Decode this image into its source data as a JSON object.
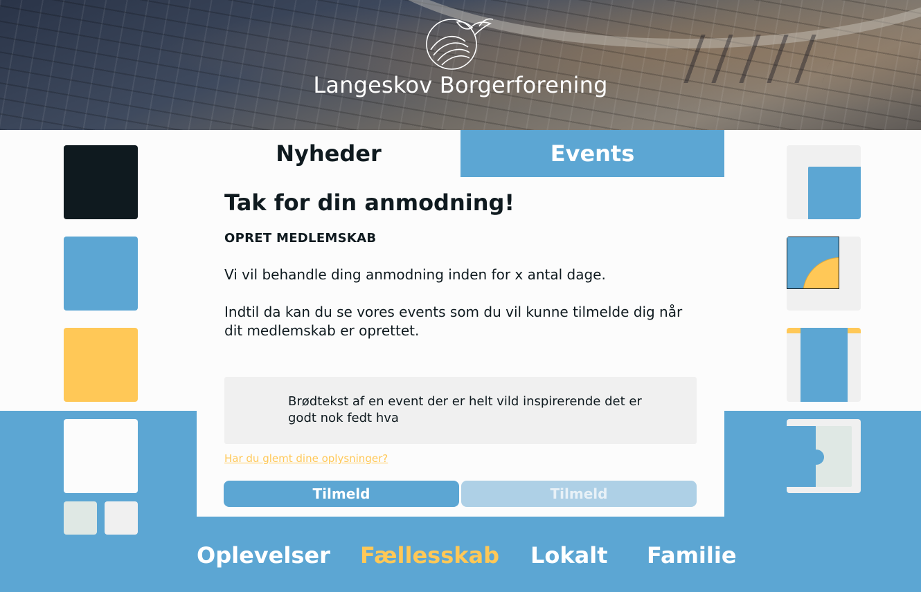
{
  "header": {
    "site_title": "Langeskov Borgerforening"
  },
  "tabs": {
    "news": "Nyheder",
    "events": "Events"
  },
  "main": {
    "heading": "Tak for din anmodning!",
    "subheading": "OPRET MEDLEMSKAB",
    "paragraph_1": "Vi vil behandle ding anmodning inden for x antal dage.",
    "paragraph_2": "Indtil da kan du se vores events som du vil kunne tilmelde dig når dit medlemskab er oprettet.",
    "info_box_text": "Brødtekst af en event der er helt vild inspirerende det er godt nok fedt hva",
    "forgot_link": "Har du glemt dine oplysninger?",
    "primary_button": "Tilmeld",
    "secondary_button": "Tilmeld"
  },
  "footer_nav": {
    "items": [
      "Oplevelser",
      "Fællesskab",
      "Lokalt",
      "Familie"
    ],
    "active": "Fællesskab"
  },
  "colors": {
    "dark": "#0f1a1f",
    "blue": "#5ca6d3",
    "yellow": "#ffc857",
    "light_grey": "#f0f0f0",
    "mint": "#dfe8e4",
    "white": "#fcfcfc"
  }
}
